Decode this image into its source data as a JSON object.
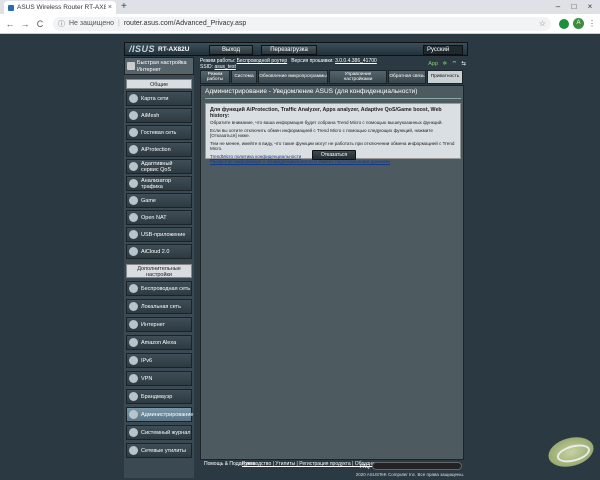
{
  "browser": {
    "tab_title": "ASUS Wireless Router RT-AX82...",
    "tab_close": "×",
    "new_tab": "+",
    "win_min": "–",
    "win_max": "□",
    "win_close": "×",
    "back": "←",
    "forward": "→",
    "reload": "C",
    "not_secure": "Не защищено",
    "url": "router.asus.com/Advanced_Privacy.asp",
    "avatar_letter": "A"
  },
  "header": {
    "logo": "/ISUS",
    "model": "RT-AX82U",
    "logout": "Выход",
    "reboot": "Перезагрузка",
    "language": "Русский"
  },
  "info": {
    "mode_label": "Режим работы:",
    "mode_value": "Беспроводной роутер",
    "firmware_label": "Версия прошивки:",
    "firmware_value": "3.0.0.4.386_41700",
    "ssid_label": "SSID:",
    "ssid_value": "asus_test",
    "app_label": "App"
  },
  "sidebar": {
    "quick_setup": "Быстрая настройка Интернет",
    "general": "Общие",
    "items": [
      "Карта сети",
      "AiMesh",
      "Гостевая сеть",
      "AiProtection",
      "Адаптивный сервис QoS",
      "Анализатор трафика",
      "Game",
      "Open NAT",
      "USB-приложение",
      "AiCloud 2.0"
    ],
    "advanced": "Дополнительные настройки",
    "advanced_items": [
      "Беспроводная сеть",
      "Локальная сеть",
      "Интернет",
      "Amazon Alexa",
      "IPv6",
      "VPN",
      "Брандмауэр",
      "Администрирование",
      "Системный журнал",
      "Сетевые утилиты"
    ]
  },
  "tabs": [
    "Режим работы",
    "Система",
    "Обновление микропрограммы",
    "Управление настройками",
    "Обратная связь",
    "Приватность"
  ],
  "content": {
    "title": "Администрирование - Уведомление ASUS (для конфиденциальности)",
    "panel_heading": "Для функций AiProtection, Traffic Analyzer, Apps analyzer, Adaptive QoS/Game boost, Web history:",
    "panel_p1": "Обратите внимание, что ваша информация будет собрана Trend Micro с помощью вышеуказанных функций.",
    "panel_p2": "Если вы хотите отключить обмен информацией с Trend Micro с помощью следующих функций, нажмите [Отказаться] ниже.",
    "panel_p3": "Тем не менее, имейте в виду, что такие функции могут не работать при отключении обмена информацией с Trend Micro.",
    "link1": "TrendMicro политика конфиденциальности",
    "link2": "Раскрытие информации о конфиденциальности и обмене персональными данными",
    "optout_button": "Отказаться"
  },
  "footer": {
    "help": "Помощь & Поддержка",
    "links": "Руководство | Утилиты | Регистрация продукта | Обратная связь",
    "faq": "FAQ",
    "copyright": "2020 ASUSTeK Computer Inc. Все права защищены."
  }
}
